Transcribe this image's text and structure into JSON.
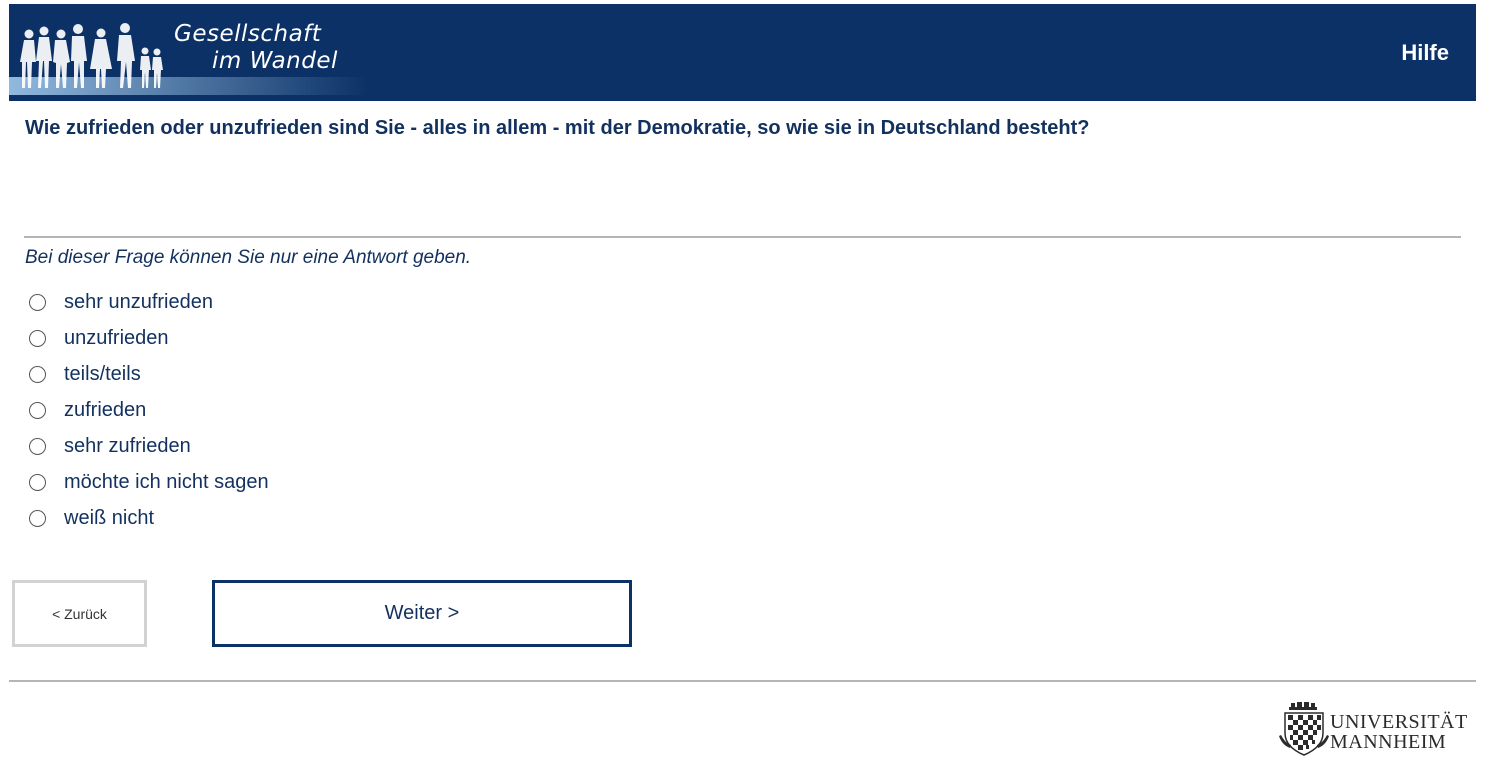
{
  "header": {
    "logo_line1": "Gesellschaft",
    "logo_line2": "im Wandel",
    "help_label": "Hilfe",
    "background_color": "#0b3166"
  },
  "question": {
    "text": "Wie zufrieden oder unzufrieden sind Sie - alles in allem - mit der Demokratie, so wie sie in Deutschland besteht?",
    "instruction": "Bei dieser Frage können Sie nur eine Antwort geben.",
    "options": [
      {
        "label": "sehr unzufrieden",
        "selected": false
      },
      {
        "label": "unzufrieden",
        "selected": false
      },
      {
        "label": "teils/teils",
        "selected": false
      },
      {
        "label": "zufrieden",
        "selected": false
      },
      {
        "label": "sehr zufrieden",
        "selected": false
      },
      {
        "label": "möchte ich nicht sagen",
        "selected": false
      },
      {
        "label": "weiß nicht",
        "selected": false
      }
    ]
  },
  "navigation": {
    "back_label": "< Zurück",
    "next_label": "Weiter >"
  },
  "footer": {
    "university_line1": "UNIVERSITÄT",
    "university_line2": "MANNHEIM"
  }
}
